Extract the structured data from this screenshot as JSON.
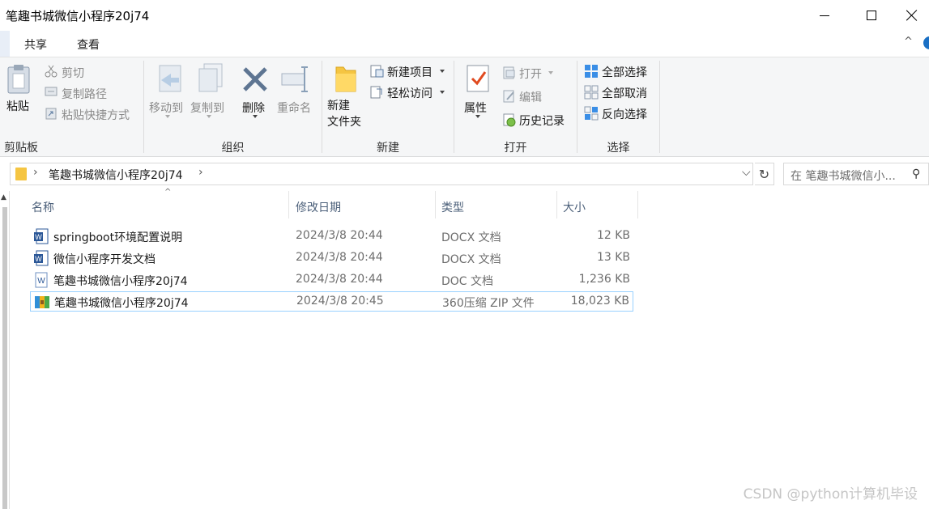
{
  "window": {
    "title": "笔趣书城微信小程序20j74"
  },
  "tabs": {
    "file_label": "",
    "share": "共享",
    "view": "查看",
    "toggle_glyph": "^"
  },
  "ribbon": {
    "clipboard": {
      "label": "剪贴板",
      "paste": "粘贴",
      "cut": "剪切",
      "copy_path": "复制路径",
      "paste_shortcut": "粘贴快捷方式"
    },
    "organize": {
      "label": "组织",
      "move_to": "移动到",
      "copy_to": "复制到",
      "delete": "删除",
      "rename": "重命名"
    },
    "new": {
      "label": "新建",
      "new_folder_line1": "新建",
      "new_folder_line2": "文件夹",
      "new_item": "新建项目",
      "easy_access": "轻松访问"
    },
    "open": {
      "label": "打开",
      "properties": "属性",
      "open": "打开",
      "edit": "编辑",
      "history": "历史记录"
    },
    "select": {
      "label": "选择",
      "select_all": "全部选择",
      "select_none": "全部取消",
      "invert": "反向选择"
    }
  },
  "address": {
    "path": "笔趣书城微信小程序20j74",
    "search_placeholder": "在 笔趣书城微信小..."
  },
  "columns": {
    "name": "名称",
    "date": "修改日期",
    "type": "类型",
    "size": "大小"
  },
  "files": [
    {
      "name": "springboot环境配置说明",
      "date": "2024/3/8 20:44",
      "type": "DOCX 文档",
      "size": "12 KB",
      "icon": "word-docx-icon"
    },
    {
      "name": "微信小程序开发文档",
      "date": "2024/3/8 20:44",
      "type": "DOCX 文档",
      "size": "13 KB",
      "icon": "word-docx-icon"
    },
    {
      "name": "笔趣书城微信小程序20j74",
      "date": "2024/3/8 20:44",
      "type": "DOC 文档",
      "size": "1,236 KB",
      "icon": "word-doc-icon"
    },
    {
      "name": "笔趣书城微信小程序20j74",
      "date": "2024/3/8 20:45",
      "type": "360压缩 ZIP 文件",
      "size": "18,023 KB",
      "icon": "zip-archive-icon",
      "selected": true
    }
  ],
  "watermark": "CSDN @python计算机毕设",
  "colors": {
    "accent": "#1a6fc4",
    "folder": "#f5c542",
    "selection_border": "#99d1ff",
    "header_text": "#4c607a"
  }
}
